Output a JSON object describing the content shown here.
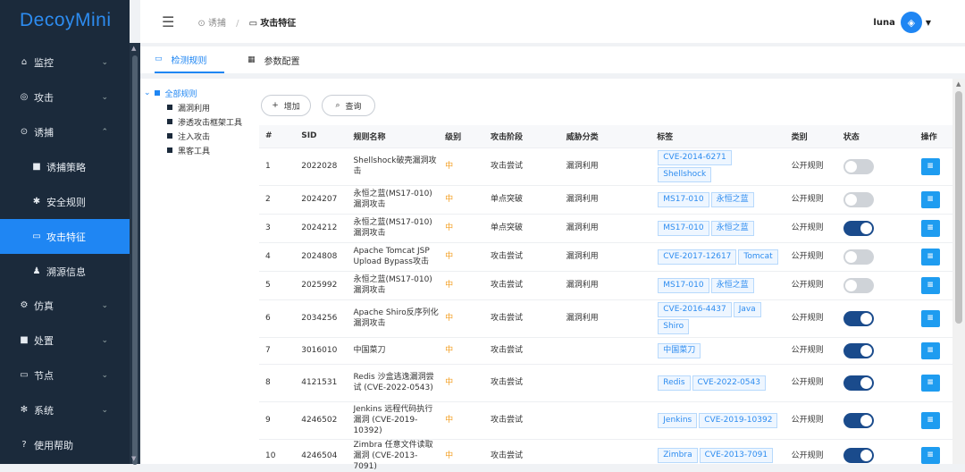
{
  "app": {
    "logo": "DecoyMini"
  },
  "sidebar": {
    "items": [
      {
        "label": "监控",
        "icon": "home-icon",
        "chev": "⌄"
      },
      {
        "label": "攻击",
        "icon": "target-icon",
        "chev": "⌄"
      },
      {
        "label": "诱捕",
        "icon": "trap-icon",
        "chev": "⌃"
      },
      {
        "label": "诱捕策略",
        "icon": "briefcase-icon"
      },
      {
        "label": "安全规则",
        "icon": "bug-icon"
      },
      {
        "label": "攻击特征",
        "icon": "card-icon"
      },
      {
        "label": "溯源信息",
        "icon": "person-icon"
      },
      {
        "label": "仿真",
        "icon": "gear-icon",
        "chev": "⌄"
      },
      {
        "label": "处置",
        "icon": "briefcase-icon",
        "chev": "⌄"
      },
      {
        "label": "节点",
        "icon": "monitor-icon",
        "chev": "⌄"
      },
      {
        "label": "系统",
        "icon": "settings-icon",
        "chev": "⌄"
      },
      {
        "label": "使用帮助",
        "icon": "help-icon"
      }
    ]
  },
  "header": {
    "breadcrumb": {
      "parent": "诱捕",
      "current": "攻击特征"
    },
    "user": "luna"
  },
  "tabs": [
    {
      "label": "检测规则"
    },
    {
      "label": "参数配置"
    }
  ],
  "tree": {
    "root": "全部规则",
    "children": [
      "漏洞利用",
      "渗透攻击框架工具",
      "注入攻击",
      "黑客工具"
    ]
  },
  "toolbar": {
    "add": "增加",
    "query": "查询"
  },
  "table": {
    "headers": [
      "#",
      "SID",
      "规则名称",
      "级别",
      "攻击阶段",
      "威胁分类",
      "标签",
      "类别",
      "状态",
      "操作"
    ],
    "rows": [
      {
        "no": "1",
        "sid": "2022028",
        "name": "Shellshock破壳漏洞攻击",
        "level": "中",
        "stage": "攻击尝试",
        "threat": "漏洞利用",
        "tags": [
          "CVE-2014-6271",
          "Shellshock"
        ],
        "cat": "公开规则",
        "status": "off"
      },
      {
        "no": "2",
        "sid": "2024207",
        "name": "永恒之蓝(MS17-010)漏洞攻击",
        "level": "中",
        "stage": "单点突破",
        "threat": "漏洞利用",
        "tags": [
          "MS17-010",
          "永恒之蓝"
        ],
        "cat": "公开规则",
        "status": "off"
      },
      {
        "no": "3",
        "sid": "2024212",
        "name": "永恒之蓝(MS17-010)漏洞攻击",
        "level": "中",
        "stage": "单点突破",
        "threat": "漏洞利用",
        "tags": [
          "MS17-010",
          "永恒之蓝"
        ],
        "cat": "公开规则",
        "status": "on"
      },
      {
        "no": "4",
        "sid": "2024808",
        "name": "Apache Tomcat JSP Upload Bypass攻击",
        "level": "中",
        "stage": "攻击尝试",
        "threat": "漏洞利用",
        "tags": [
          "CVE-2017-12617",
          "Tomcat"
        ],
        "cat": "公开规则",
        "status": "off"
      },
      {
        "no": "5",
        "sid": "2025992",
        "name": "永恒之蓝(MS17-010)漏洞攻击",
        "level": "中",
        "stage": "攻击尝试",
        "threat": "漏洞利用",
        "tags": [
          "MS17-010",
          "永恒之蓝"
        ],
        "cat": "公开规则",
        "status": "off"
      },
      {
        "no": "6",
        "sid": "2034256",
        "name": "Apache Shiro反序列化漏洞攻击",
        "level": "中",
        "stage": "攻击尝试",
        "threat": "漏洞利用",
        "tags": [
          "CVE-2016-4437",
          "Java",
          "Shiro"
        ],
        "cat": "公开规则",
        "status": "on"
      },
      {
        "no": "7",
        "sid": "3016010",
        "name": "中国菜刀",
        "level": "中",
        "stage": "攻击尝试",
        "threat": "",
        "tags": [
          "中国菜刀"
        ],
        "cat": "公开规则",
        "status": "on"
      },
      {
        "no": "8",
        "sid": "4121531",
        "name": "Redis 沙盒逃逸漏洞尝试 (CVE-2022-0543)",
        "level": "中",
        "stage": "攻击尝试",
        "threat": "",
        "tags": [
          "Redis",
          "CVE-2022-0543"
        ],
        "cat": "公开规则",
        "status": "on"
      },
      {
        "no": "9",
        "sid": "4246502",
        "name": "Jenkins 远程代码执行漏洞 (CVE-2019-10392)",
        "level": "中",
        "stage": "攻击尝试",
        "threat": "",
        "tags": [
          "Jenkins",
          "CVE-2019-10392"
        ],
        "cat": "公开规则",
        "status": "on"
      },
      {
        "no": "10",
        "sid": "4246504",
        "name": "Zimbra 任意文件读取漏洞 (CVE-2013-7091)",
        "level": "中",
        "stage": "攻击尝试",
        "threat": "",
        "tags": [
          "Zimbra",
          "CVE-2013-7091"
        ],
        "cat": "公开规则",
        "status": "on"
      }
    ]
  }
}
